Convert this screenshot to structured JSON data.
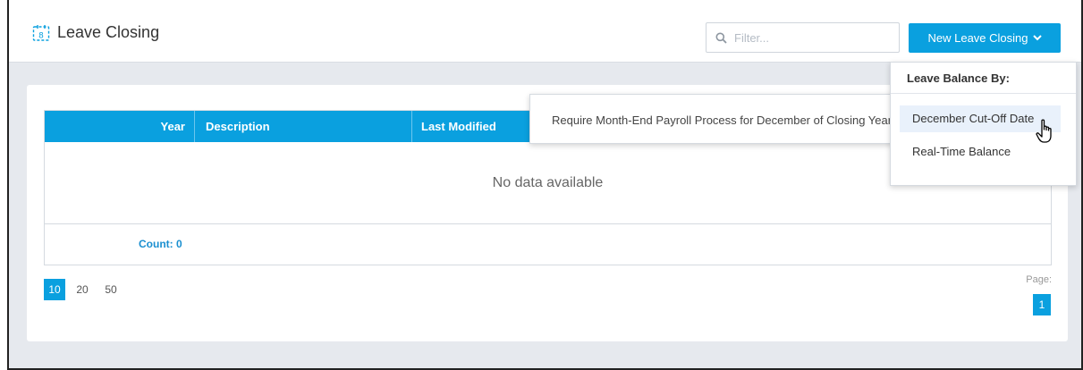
{
  "page": {
    "title": "Leave Closing",
    "title_icon": "calendar-icon"
  },
  "toolbar": {
    "filter_placeholder": "Filter...",
    "new_button_label": "New Leave Closing",
    "accent_color": "#0aa0df"
  },
  "table": {
    "columns": [
      "Year",
      "Description",
      "Last Modified"
    ],
    "empty_message": "No data available",
    "count_label": "Count: 0"
  },
  "pagination": {
    "page_sizes": [
      "10",
      "20",
      "50"
    ],
    "selected_page_size": "10",
    "page_label": "Page:",
    "current_page": "1"
  },
  "dropdown": {
    "header": "Leave Balance By:",
    "items": [
      "December Cut-Off Date",
      "Real-Time Balance"
    ],
    "hovered_item": "December Cut-Off Date"
  },
  "tooltip": {
    "text": "Require Month-End Payroll Process for December of Closing Year"
  }
}
